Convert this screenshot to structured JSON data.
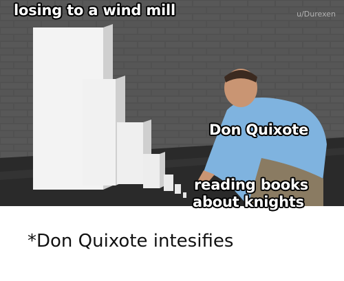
{
  "meme": {
    "caption_top_left": "losing to a wind mill",
    "watermark": "u/Durexen",
    "caption_man": "Don Quixote",
    "caption_bottom_line1": "reading books",
    "caption_bottom_line2": "about knights"
  },
  "footer": {
    "text": "*Don Quixote intesifies"
  },
  "colors": {
    "wall": "#5b5b5b",
    "floor": "#2b2b2b",
    "shirt": "#7fb3df",
    "domino": "#f2f2f2"
  }
}
